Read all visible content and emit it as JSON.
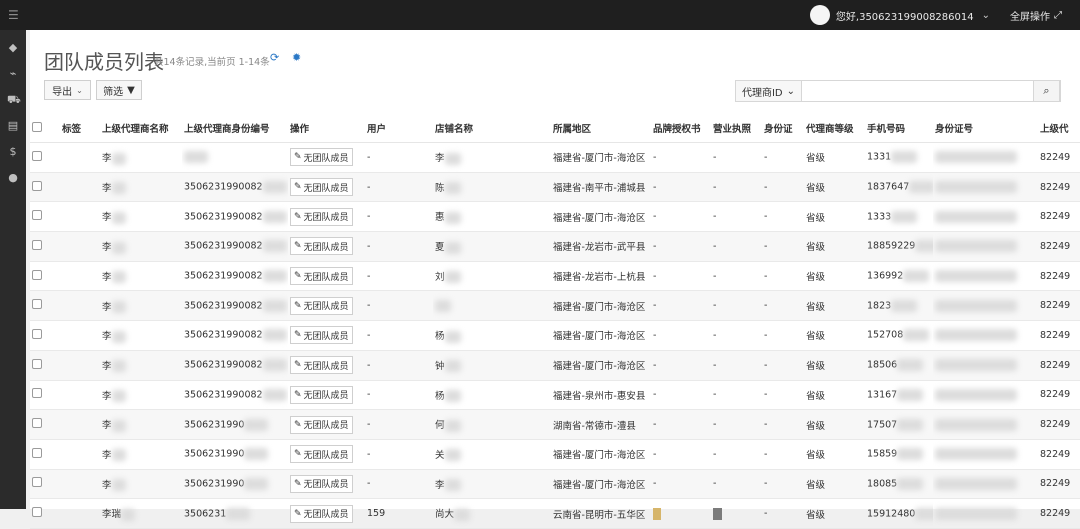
{
  "topbar": {
    "user_text": "您好,350623199008286014",
    "fullscreen_label": "全屏操作"
  },
  "page": {
    "title": "团队成员列表",
    "meta": "共14条记录,当前页 1-14条"
  },
  "toolbar": {
    "export_label": "导出",
    "filter_label": "筛选",
    "search_select": "代理商ID",
    "search_value": "",
    "search_placeholder": ""
  },
  "table": {
    "headers": [
      "",
      "标签",
      "上级代理商名称",
      "上级代理商身份编号",
      "操作",
      "用户",
      "店铺名称",
      "所属地区",
      "品牌授权书",
      "营业执照",
      "身份证",
      "代理商等级",
      "手机号码",
      "身份证号",
      "上级代"
    ],
    "rows": [
      {
        "agent_name": "李",
        "agent_id": "",
        "user": "-",
        "shop": "李",
        "region": "福建省-厦门市-海沧区",
        "brand": "-",
        "license": "-",
        "idcard": "-",
        "level": "省级",
        "phone": "1331",
        "idno": "",
        "up": "82249"
      },
      {
        "agent_name": "李",
        "agent_id": "3506231990082",
        "user": "-",
        "shop": "陈",
        "region": "福建省-南平市-浦城县",
        "brand": "-",
        "license": "-",
        "idcard": "-",
        "level": "省级",
        "phone": "1837647",
        "idno": "",
        "up": "82249"
      },
      {
        "agent_name": "李",
        "agent_id": "3506231990082",
        "user": "-",
        "shop": "惠",
        "region": "福建省-厦门市-海沧区",
        "brand": "-",
        "license": "-",
        "idcard": "-",
        "level": "省级",
        "phone": "1333",
        "idno": "",
        "up": "82249"
      },
      {
        "agent_name": "李",
        "agent_id": "3506231990082",
        "user": "-",
        "shop": "夏",
        "region": "福建省-龙岩市-武平县",
        "brand": "-",
        "license": "-",
        "idcard": "-",
        "level": "省级",
        "phone": "18859229",
        "idno": "",
        "up": "82249"
      },
      {
        "agent_name": "李",
        "agent_id": "3506231990082",
        "user": "-",
        "shop": "刘",
        "region": "福建省-龙岩市-上杭县",
        "brand": "-",
        "license": "-",
        "idcard": "-",
        "level": "省级",
        "phone": "136992",
        "idno": "",
        "up": "82249"
      },
      {
        "agent_name": "李",
        "agent_id": "3506231990082",
        "user": "-",
        "shop": "",
        "region": "福建省-厦门市-海沧区",
        "brand": "-",
        "license": "-",
        "idcard": "-",
        "level": "省级",
        "phone": "1823",
        "idno": "",
        "up": "82249"
      },
      {
        "agent_name": "李",
        "agent_id": "3506231990082",
        "user": "-",
        "shop": "杨",
        "region": "福建省-厦门市-海沧区",
        "brand": "-",
        "license": "-",
        "idcard": "-",
        "level": "省级",
        "phone": "152708",
        "idno": "",
        "up": "82249"
      },
      {
        "agent_name": "李",
        "agent_id": "3506231990082",
        "user": "-",
        "shop": "钟",
        "region": "福建省-厦门市-海沧区",
        "brand": "-",
        "license": "-",
        "idcard": "-",
        "level": "省级",
        "phone": "18506",
        "idno": "",
        "up": "82249"
      },
      {
        "agent_name": "李",
        "agent_id": "3506231990082",
        "user": "-",
        "shop": "杨",
        "region": "福建省-泉州市-惠安县",
        "brand": "-",
        "license": "-",
        "idcard": "-",
        "level": "省级",
        "phone": "13167",
        "idno": "",
        "up": "82249"
      },
      {
        "agent_name": "李",
        "agent_id": "3506231990",
        "user": "-",
        "shop": "何",
        "region": "湖南省-常德市-澧县",
        "brand": "-",
        "license": "-",
        "idcard": "-",
        "level": "省级",
        "phone": "17507",
        "idno": "",
        "up": "82249"
      },
      {
        "agent_name": "李",
        "agent_id": "3506231990",
        "user": "-",
        "shop": "关",
        "region": "福建省-厦门市-海沧区",
        "brand": "-",
        "license": "-",
        "idcard": "-",
        "level": "省级",
        "phone": "15859",
        "idno": "",
        "up": "82249"
      },
      {
        "agent_name": "李",
        "agent_id": "3506231990",
        "user": "-",
        "shop": "李",
        "region": "福建省-厦门市-海沧区",
        "brand": "-",
        "license": "-",
        "idcard": "-",
        "level": "省级",
        "phone": "18085",
        "idno": "",
        "up": "82249"
      },
      {
        "agent_name": "李瑞",
        "agent_id": "3506231",
        "user": "159",
        "shop": "尚大",
        "region": "云南省-昆明市-五华区",
        "brand": "",
        "license": "",
        "idcard": "-",
        "level": "省级",
        "phone": "15912480",
        "idno": "",
        "up": "82249"
      }
    ],
    "action_label": "无团队成员"
  }
}
